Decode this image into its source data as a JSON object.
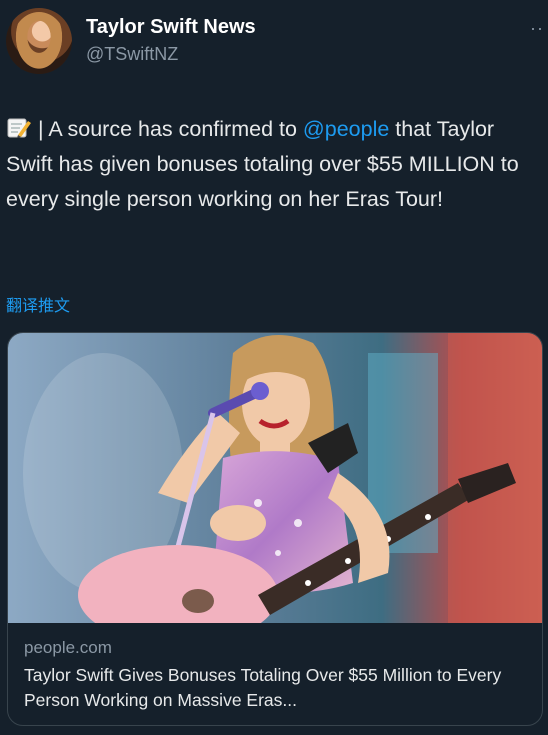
{
  "author": {
    "display_name": "Taylor Swift News",
    "handle": "@TSwiftNZ",
    "avatar_icon": "profile-photo",
    "more_label": "··"
  },
  "tweet": {
    "icon": "memo-icon",
    "text_part1": "| A source has confirmed to ",
    "mention": "@people",
    "text_part2": " that Taylor Swift has given bonuses totaling over $55 MILLION to every single person working on her Eras Tour!"
  },
  "translate_label": "翻译推文",
  "link_card": {
    "image_icon": "concert-photo",
    "domain": "people.com",
    "title": "Taylor Swift Gives Bonuses Totaling Over $55 Million to Every Person Working on Massive Eras..."
  },
  "colors": {
    "background": "#15202b",
    "text": "#e7e9ea",
    "secondary": "#8b98a5",
    "link": "#1d9bf0",
    "border": "#38444d"
  }
}
